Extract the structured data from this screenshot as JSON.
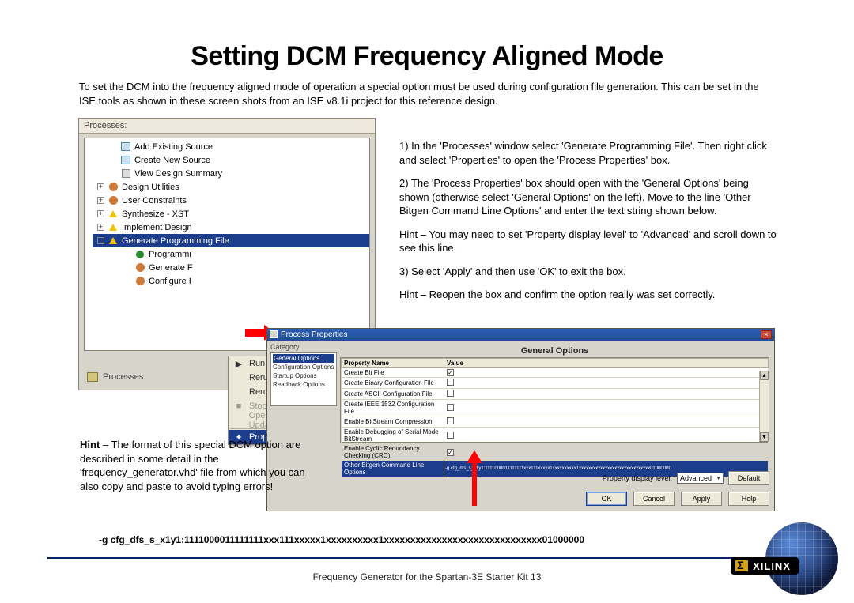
{
  "title": "Setting DCM Frequency Aligned Mode",
  "intro": "To set the DCM into the frequency aligned mode of operation a special option must be used during configuration file generation. This can be set in the ISE tools as shown in these screen shots from an ISE v8.1i project for this reference design.",
  "processes_panel": {
    "header": "Processes:",
    "footer_tab": "Processes",
    "items": [
      {
        "label": "Add Existing Source",
        "icon": "doc",
        "expander": null,
        "indent": 1
      },
      {
        "label": "Create New Source",
        "icon": "doc",
        "expander": null,
        "indent": 1
      },
      {
        "label": "View Design Summary",
        "icon": "report",
        "expander": null,
        "indent": 1
      },
      {
        "label": "Design Utilities",
        "icon": "gear",
        "expander": "+",
        "indent": 0
      },
      {
        "label": "User Constraints",
        "icon": "gear",
        "expander": "+",
        "indent": 0
      },
      {
        "label": "Synthesize - XST",
        "icon": "warn",
        "expander": "+",
        "indent": 0
      },
      {
        "label": "Implement Design",
        "icon": "warn",
        "expander": "+",
        "indent": 0
      },
      {
        "label": "Generate Programming File",
        "icon": "warn",
        "expander": "-",
        "indent": 0,
        "selected": true
      },
      {
        "label": "Programming File Generation Report",
        "icon": "green",
        "expander": null,
        "indent": 2,
        "truncated": "Programmi"
      },
      {
        "label": "Generate PROM, ACE, or JTAG File",
        "icon": "gear",
        "expander": null,
        "indent": 2,
        "truncated": "Generate F"
      },
      {
        "label": "Configure Device (iMPACT)",
        "icon": "gear",
        "expander": null,
        "indent": 2,
        "truncated": "Configure I"
      }
    ]
  },
  "context_menu": {
    "items": [
      {
        "label": "Run",
        "icon": "▶"
      },
      {
        "label": "Rerun"
      },
      {
        "label": "Rerun All"
      },
      {
        "label": "Stop",
        "icon": "■",
        "disabled": true
      },
      {
        "label": "Open Without Updating",
        "disabled": true
      },
      {
        "sep": true
      },
      {
        "label": "Properties…",
        "icon": "✦",
        "selected": true
      }
    ]
  },
  "body_text": {
    "p1": "1) In the 'Processes' window select 'Generate Programming File'. Then right click and select 'Properties' to open the 'Process Properties' box.",
    "p2": "2) The 'Process Properties' box should open with the 'General Options' being shown (otherwise select 'General Options' on the left). Move to the line 'Other Bitgen Command Line Options' and enter the text string shown below.",
    "p3": "Hint – You may need to set 'Property display level' to 'Advanced' and scroll down to see this line.",
    "p4": "3) Select 'Apply' and then use 'OK' to exit the box.",
    "p5": "Hint – Reopen the box and confirm the option really was set correctly."
  },
  "process_properties": {
    "title": "Process Properties",
    "category_label": "Category",
    "categories": [
      "General Options",
      "Configuration Options",
      "Startup Options",
      "Readback Options"
    ],
    "section_title": "General Options",
    "columns": [
      "Property Name",
      "Value"
    ],
    "rows": [
      {
        "name": "Create Bit File",
        "value_type": "check",
        "checked": true,
        "cut_top": true
      },
      {
        "name": "Create Binary Configuration File",
        "value_type": "check",
        "checked": false
      },
      {
        "name": "Create ASCII Configuration File",
        "value_type": "check",
        "checked": false
      },
      {
        "name": "Create IEEE 1532 Configuration File",
        "value_type": "check",
        "checked": false
      },
      {
        "name": "Enable BitStream Compression",
        "value_type": "check",
        "checked": false
      },
      {
        "name": "Enable Debugging of Serial Mode BitStream",
        "value_type": "check",
        "checked": false
      },
      {
        "name": "Enable Cyclic Redundancy Checking (CRC)",
        "value_type": "check",
        "checked": true
      },
      {
        "name": "Other Bitgen Command Line Options",
        "value_type": "text",
        "value": "-g cfg_dfs_s_x1y1:1111000011111111xxx111xxxxx1xxxxxxxxxx1xxxxxxxxxxxxxxxxxxxxxxxxxxxxxx01000000",
        "selected": true
      }
    ],
    "display_level_label": "Property display level:",
    "display_level_value": "Advanced",
    "buttons": {
      "default": "Default",
      "ok": "OK",
      "cancel": "Cancel",
      "apply": "Apply",
      "help": "Help"
    }
  },
  "hint_left": {
    "prefix": "Hint",
    "text": " – The format of this special DCM option are described in some detail in the 'frequency_generator.vhd' file from which you can also copy and paste to avoid typing errors!"
  },
  "command_line": "-g cfg_dfs_s_x1y1:1111000011111111xxx111xxxxx1xxxxxxxxxx1xxxxxxxxxxxxxxxxxxxxxxxxxxxxxx01000000",
  "footer_text": "Frequency Generator for the Spartan-3E Starter Kit 13",
  "brand": "XILINX"
}
